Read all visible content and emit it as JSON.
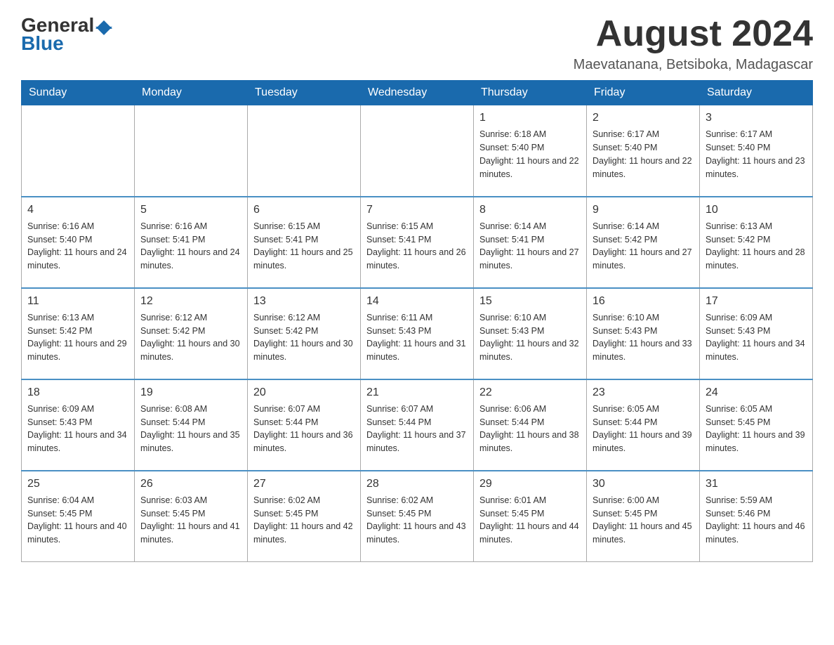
{
  "header": {
    "logo_general": "General",
    "logo_blue": "Blue",
    "month_title": "August 2024",
    "location": "Maevatanana, Betsiboka, Madagascar"
  },
  "days_of_week": [
    "Sunday",
    "Monday",
    "Tuesday",
    "Wednesday",
    "Thursday",
    "Friday",
    "Saturday"
  ],
  "weeks": [
    [
      {
        "day": "",
        "info": ""
      },
      {
        "day": "",
        "info": ""
      },
      {
        "day": "",
        "info": ""
      },
      {
        "day": "",
        "info": ""
      },
      {
        "day": "1",
        "info": "Sunrise: 6:18 AM\nSunset: 5:40 PM\nDaylight: 11 hours and 22 minutes."
      },
      {
        "day": "2",
        "info": "Sunrise: 6:17 AM\nSunset: 5:40 PM\nDaylight: 11 hours and 22 minutes."
      },
      {
        "day": "3",
        "info": "Sunrise: 6:17 AM\nSunset: 5:40 PM\nDaylight: 11 hours and 23 minutes."
      }
    ],
    [
      {
        "day": "4",
        "info": "Sunrise: 6:16 AM\nSunset: 5:40 PM\nDaylight: 11 hours and 24 minutes."
      },
      {
        "day": "5",
        "info": "Sunrise: 6:16 AM\nSunset: 5:41 PM\nDaylight: 11 hours and 24 minutes."
      },
      {
        "day": "6",
        "info": "Sunrise: 6:15 AM\nSunset: 5:41 PM\nDaylight: 11 hours and 25 minutes."
      },
      {
        "day": "7",
        "info": "Sunrise: 6:15 AM\nSunset: 5:41 PM\nDaylight: 11 hours and 26 minutes."
      },
      {
        "day": "8",
        "info": "Sunrise: 6:14 AM\nSunset: 5:41 PM\nDaylight: 11 hours and 27 minutes."
      },
      {
        "day": "9",
        "info": "Sunrise: 6:14 AM\nSunset: 5:42 PM\nDaylight: 11 hours and 27 minutes."
      },
      {
        "day": "10",
        "info": "Sunrise: 6:13 AM\nSunset: 5:42 PM\nDaylight: 11 hours and 28 minutes."
      }
    ],
    [
      {
        "day": "11",
        "info": "Sunrise: 6:13 AM\nSunset: 5:42 PM\nDaylight: 11 hours and 29 minutes."
      },
      {
        "day": "12",
        "info": "Sunrise: 6:12 AM\nSunset: 5:42 PM\nDaylight: 11 hours and 30 minutes."
      },
      {
        "day": "13",
        "info": "Sunrise: 6:12 AM\nSunset: 5:42 PM\nDaylight: 11 hours and 30 minutes."
      },
      {
        "day": "14",
        "info": "Sunrise: 6:11 AM\nSunset: 5:43 PM\nDaylight: 11 hours and 31 minutes."
      },
      {
        "day": "15",
        "info": "Sunrise: 6:10 AM\nSunset: 5:43 PM\nDaylight: 11 hours and 32 minutes."
      },
      {
        "day": "16",
        "info": "Sunrise: 6:10 AM\nSunset: 5:43 PM\nDaylight: 11 hours and 33 minutes."
      },
      {
        "day": "17",
        "info": "Sunrise: 6:09 AM\nSunset: 5:43 PM\nDaylight: 11 hours and 34 minutes."
      }
    ],
    [
      {
        "day": "18",
        "info": "Sunrise: 6:09 AM\nSunset: 5:43 PM\nDaylight: 11 hours and 34 minutes."
      },
      {
        "day": "19",
        "info": "Sunrise: 6:08 AM\nSunset: 5:44 PM\nDaylight: 11 hours and 35 minutes."
      },
      {
        "day": "20",
        "info": "Sunrise: 6:07 AM\nSunset: 5:44 PM\nDaylight: 11 hours and 36 minutes."
      },
      {
        "day": "21",
        "info": "Sunrise: 6:07 AM\nSunset: 5:44 PM\nDaylight: 11 hours and 37 minutes."
      },
      {
        "day": "22",
        "info": "Sunrise: 6:06 AM\nSunset: 5:44 PM\nDaylight: 11 hours and 38 minutes."
      },
      {
        "day": "23",
        "info": "Sunrise: 6:05 AM\nSunset: 5:44 PM\nDaylight: 11 hours and 39 minutes."
      },
      {
        "day": "24",
        "info": "Sunrise: 6:05 AM\nSunset: 5:45 PM\nDaylight: 11 hours and 39 minutes."
      }
    ],
    [
      {
        "day": "25",
        "info": "Sunrise: 6:04 AM\nSunset: 5:45 PM\nDaylight: 11 hours and 40 minutes."
      },
      {
        "day": "26",
        "info": "Sunrise: 6:03 AM\nSunset: 5:45 PM\nDaylight: 11 hours and 41 minutes."
      },
      {
        "day": "27",
        "info": "Sunrise: 6:02 AM\nSunset: 5:45 PM\nDaylight: 11 hours and 42 minutes."
      },
      {
        "day": "28",
        "info": "Sunrise: 6:02 AM\nSunset: 5:45 PM\nDaylight: 11 hours and 43 minutes."
      },
      {
        "day": "29",
        "info": "Sunrise: 6:01 AM\nSunset: 5:45 PM\nDaylight: 11 hours and 44 minutes."
      },
      {
        "day": "30",
        "info": "Sunrise: 6:00 AM\nSunset: 5:45 PM\nDaylight: 11 hours and 45 minutes."
      },
      {
        "day": "31",
        "info": "Sunrise: 5:59 AM\nSunset: 5:46 PM\nDaylight: 11 hours and 46 minutes."
      }
    ]
  ]
}
